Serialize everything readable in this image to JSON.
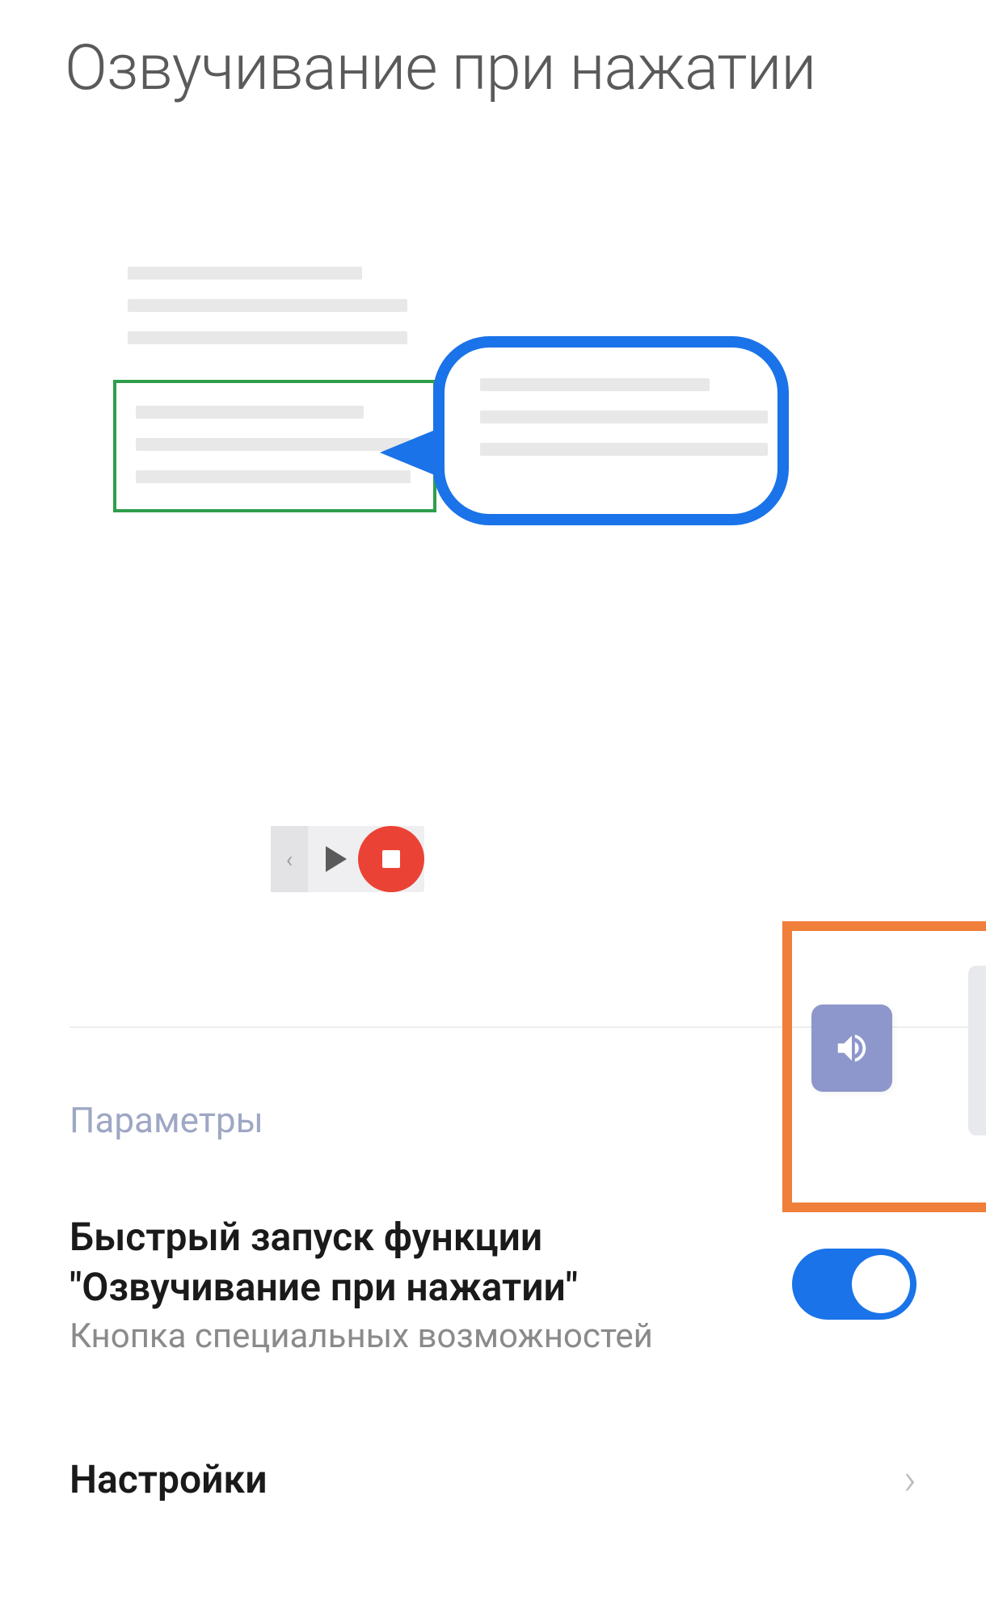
{
  "header": {
    "title": "Озвучивание при нажатии"
  },
  "settings": {
    "section_label": "Параметры",
    "quick_launch": {
      "title": "Быстрый запуск функции \"Озвучивание при нажатии\"",
      "subtitle": "Кнопка специальных возможностей",
      "enabled": true
    },
    "more": {
      "label": "Настройки"
    }
  },
  "icons": {
    "prev": "‹",
    "chev_right": "›"
  },
  "colors": {
    "accent": "#1a73e8",
    "highlight_border": "#ef7f3a",
    "green_select": "#2e9e4a",
    "stop_red": "#ea4335",
    "floating_button": "#8d97cc"
  }
}
